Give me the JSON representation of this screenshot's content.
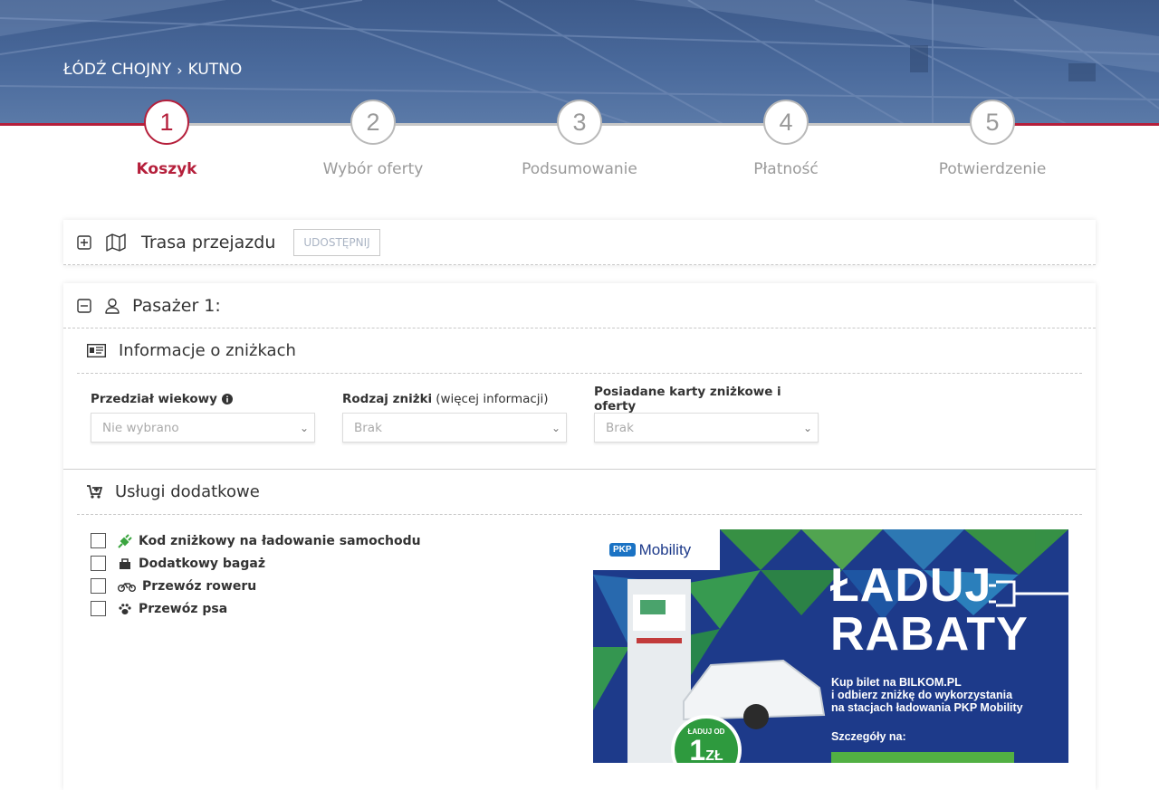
{
  "breadcrumb": {
    "from": "ŁÓDŹ CHOJNY",
    "to": "KUTNO"
  },
  "steps": [
    {
      "number": "1",
      "label": "Koszyk",
      "active": true
    },
    {
      "number": "2",
      "label": "Wybór oferty",
      "active": false
    },
    {
      "number": "3",
      "label": "Podsumowanie",
      "active": false
    },
    {
      "number": "4",
      "label": "Płatność",
      "active": false
    },
    {
      "number": "5",
      "label": "Potwierdzenie",
      "active": false
    }
  ],
  "route_panel": {
    "title": "Trasa przejazdu",
    "share_label": "UDOSTĘPNIJ"
  },
  "passenger_panel": {
    "title": "Pasażer 1:",
    "discounts": {
      "title": "Informacje o zniżkach",
      "age_label": "Przedział wiekowy",
      "age_value": "Nie wybrano",
      "discount_label": "Rodzaj zniżki",
      "discount_more": "(więcej informacji)",
      "discount_value": "Brak",
      "cards_label": "Posiadane karty zniżkowe i oferty",
      "cards_value": "Brak"
    },
    "services": {
      "title": "Usługi dodatkowe",
      "items": [
        {
          "label": "Kod zniżkowy na ładowanie samochodu",
          "icon": "ev-plug-icon"
        },
        {
          "label": "Dodatkowy bagaż",
          "icon": "luggage-icon"
        },
        {
          "label": "Przewóz roweru",
          "icon": "bicycle-icon"
        },
        {
          "label": "Przewóz psa",
          "icon": "paw-icon"
        }
      ]
    }
  },
  "banner": {
    "logo_badge": "PKP",
    "logo_text": "Mobility",
    "headline_1": "ŁADUJ",
    "headline_2": "RABATY",
    "body_1": "Kup bilet na BILKOM.PL",
    "body_2": "i odbierz zniżkę do wykorzystania",
    "body_3": "na stacjach ładowania PKP Mobility",
    "details": "Szczegóły na:",
    "price_small": "ŁADUJ OD",
    "price_value": "1",
    "price_unit": "ZŁ"
  },
  "colors": {
    "accent": "#b51f3b",
    "banner_blue": "#1d3a8a",
    "banner_green": "#52b043"
  }
}
